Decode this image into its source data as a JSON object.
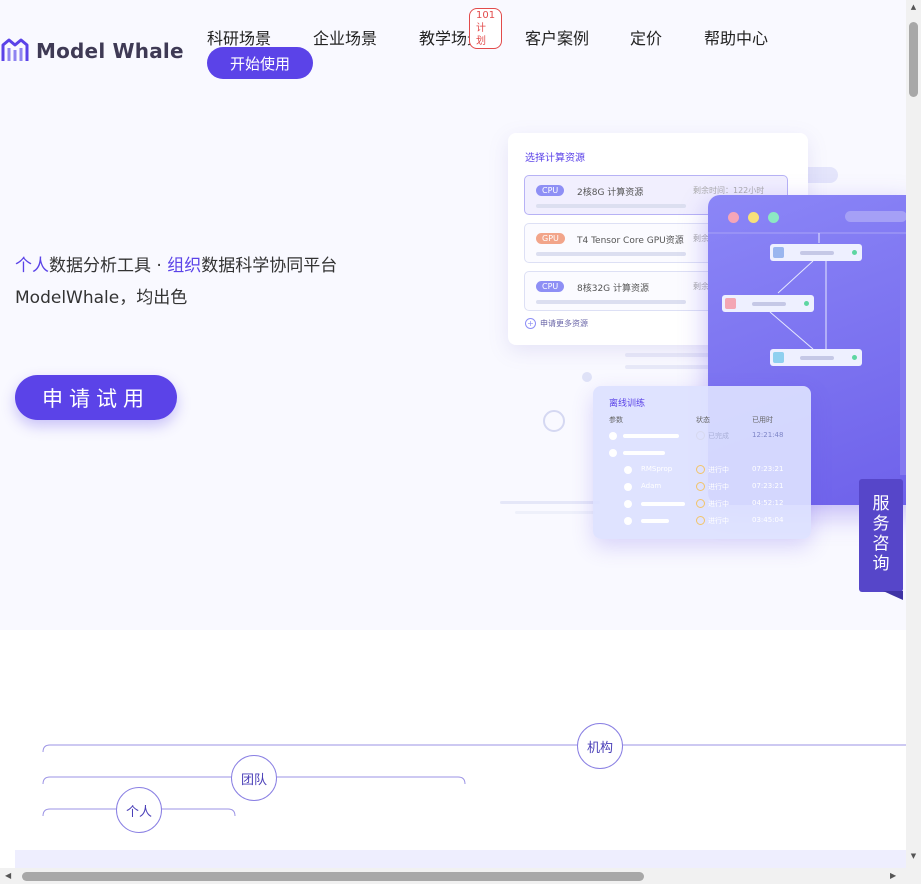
{
  "brand": {
    "name": "Model Whale"
  },
  "nav": {
    "items": [
      "科研场景",
      "企业场景",
      "教学场景",
      "客户案例",
      "定价",
      "帮助中心"
    ],
    "badge": "101计划",
    "start_label": "开始使用"
  },
  "hero": {
    "slogan_part1": "个人",
    "slogan_part2": "数据分析工具 · ",
    "slogan_part3": "组织",
    "slogan_part4": "数据科学协同平台",
    "slogan_line2": "ModelWhale，均出色",
    "apply_label": "申请试用"
  },
  "resource_card": {
    "title": "选择计算资源",
    "rows": [
      {
        "tag": "CPU",
        "name": "2核8G 计算资源",
        "time": "剩余时间：122小时"
      },
      {
        "tag": "GPU",
        "name": "T4 Tensor Core GPU资源",
        "time": "剩余"
      },
      {
        "tag": "CPU",
        "name": "8核32G 计算资源",
        "time": "剩余"
      }
    ],
    "more": "申请更多资源"
  },
  "train_card": {
    "title": "离线训练",
    "headers": [
      "参数",
      "状态",
      "已用时"
    ],
    "rows": [
      {
        "name": "",
        "status": "已完成",
        "time": "12:21:48"
      },
      {
        "name": "RMSprop",
        "status": "进行中",
        "time": "07:23:21"
      },
      {
        "name": "Adam",
        "status": "进行中",
        "time": "07:23:21"
      },
      {
        "name": "",
        "status": "进行中",
        "time": "04:52:12"
      },
      {
        "name": "",
        "status": "进行中",
        "time": "03:45:04"
      }
    ]
  },
  "service": {
    "label": "服务咨询"
  },
  "levels": {
    "org": "机构",
    "team": "团队",
    "person": "个人"
  },
  "colors": {
    "primary": "#5b43e8",
    "service": "#5646c9",
    "badge": "#e24b4b"
  }
}
